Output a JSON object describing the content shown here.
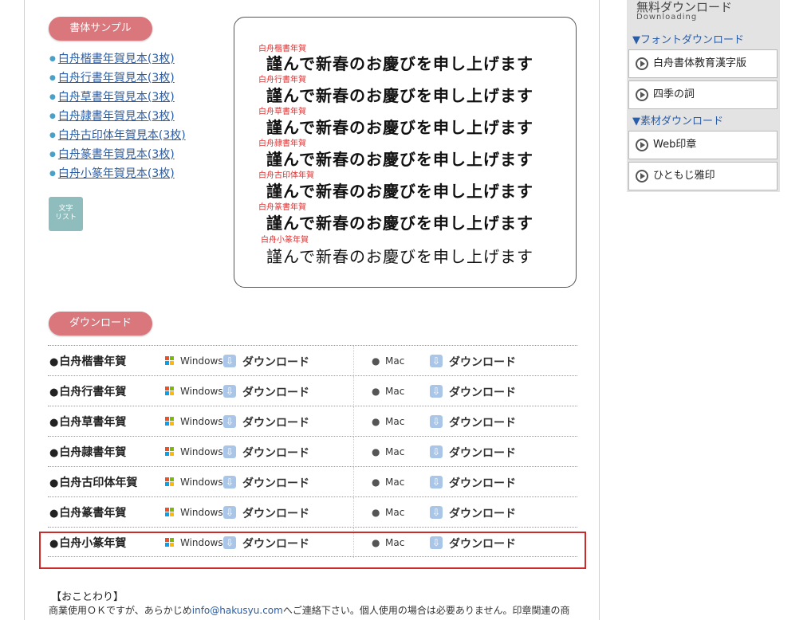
{
  "font_samples": {
    "header": "書体サンプル",
    "links": [
      "白舟楷書年賀見本(3枚)",
      "白舟行書年賀見本(3枚)",
      "白舟草書年賀見本(3枚)",
      "白舟隷書年賀見本(3枚)",
      "白舟古印体年賀見本(3枚)",
      "白舟篆書年賀見本(3枚)",
      "白舟小篆年賀見本(3枚)"
    ],
    "moji_list_button": [
      "文字",
      "リスト"
    ]
  },
  "sample_box": {
    "rows": [
      {
        "tag": "白舟楷書年賀",
        "text": "謹んで新春のお慶びを申し上げます"
      },
      {
        "tag": "白舟行書年賀",
        "text": "謹んで新春のお慶びを申し上げます"
      },
      {
        "tag": "白舟草書年賀",
        "text": "謹んで新春のお慶びを申し上げます"
      },
      {
        "tag": "白舟隷書年賀",
        "text": "謹んで新春のお慶びを申し上げます"
      },
      {
        "tag": "白舟古印体年賀",
        "text": "謹んで新春のお慶びを申し上げます"
      },
      {
        "tag": "白舟篆書年賀",
        "text": "謹んで新春のお慶びを申し上げます"
      },
      {
        "tag": "白舟小篆年賀",
        "text": "謹んで新春のお慶びを申し上げます"
      }
    ]
  },
  "download": {
    "header": "ダウンロード",
    "windows_label": "Windows",
    "mac_label": "Mac",
    "download_label": "ダウンロード",
    "fonts": [
      "白舟楷書年賀",
      "白舟行書年賀",
      "白舟草書年賀",
      "白舟隷書年賀",
      "白舟古印体年賀",
      "白舟篆書年賀",
      "白舟小篆年賀"
    ]
  },
  "notice": {
    "heading": "【おことわり】",
    "text_before_email": "商業使用ＯＫですが、あらかじめ",
    "email": "info@hakusyu.com",
    "text_after_email": "へご連絡下さい。個人使用の場合は必要ありません。印章関連の商"
  },
  "sidebar": {
    "title": "無料ダウンロード",
    "subtitle": "Downloading",
    "font_section": "▼フォントダウンロード",
    "font_buttons": [
      "白舟書体教育漢字版",
      "四季の詞"
    ],
    "material_section": "▼素材ダウンロード",
    "material_buttons": [
      "Web印章",
      "ひともじ雅印"
    ]
  },
  "colors": {
    "pill": "#d9777d",
    "link": "#2a5da8",
    "highlight_border": "#cc2b2b",
    "sample_tag": "#e03030"
  }
}
